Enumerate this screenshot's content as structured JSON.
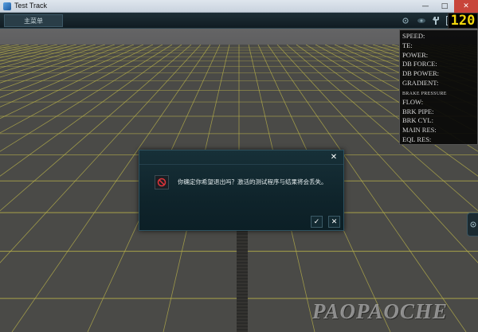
{
  "window": {
    "title": "Test Track",
    "controls": {
      "minimize": "—",
      "maximize": "□",
      "close": "✕"
    }
  },
  "topbar": {
    "menu_label": "主菜单",
    "icons": [
      "camera-icon",
      "eye-icon",
      "wrench-icon",
      "save-icon"
    ],
    "speed_value": "120"
  },
  "telemetry": {
    "rows": [
      "SPEED:",
      "TE:",
      "POWER:",
      "DB FORCE:",
      "DB POWER:",
      "GRADIENT:"
    ],
    "brake_header": "BRAKE PRESSURE",
    "brake_rows": [
      "FLOW:",
      "BRK PIPE:",
      "BRK CYL:",
      "MAIN RES:",
      "EQL RES:"
    ]
  },
  "dialog": {
    "close": "✕",
    "message": "你确定你希望退出吗？激活的测试程序与结果将会丢失。",
    "confirm": "✓",
    "cancel": "✕"
  },
  "watermark": "PAOPAOCHE",
  "colors": {
    "speed": "#f1d60c",
    "grid": "#b9b24a",
    "dialog_bg": "#0f242b",
    "no_entry": "#e0343a"
  }
}
